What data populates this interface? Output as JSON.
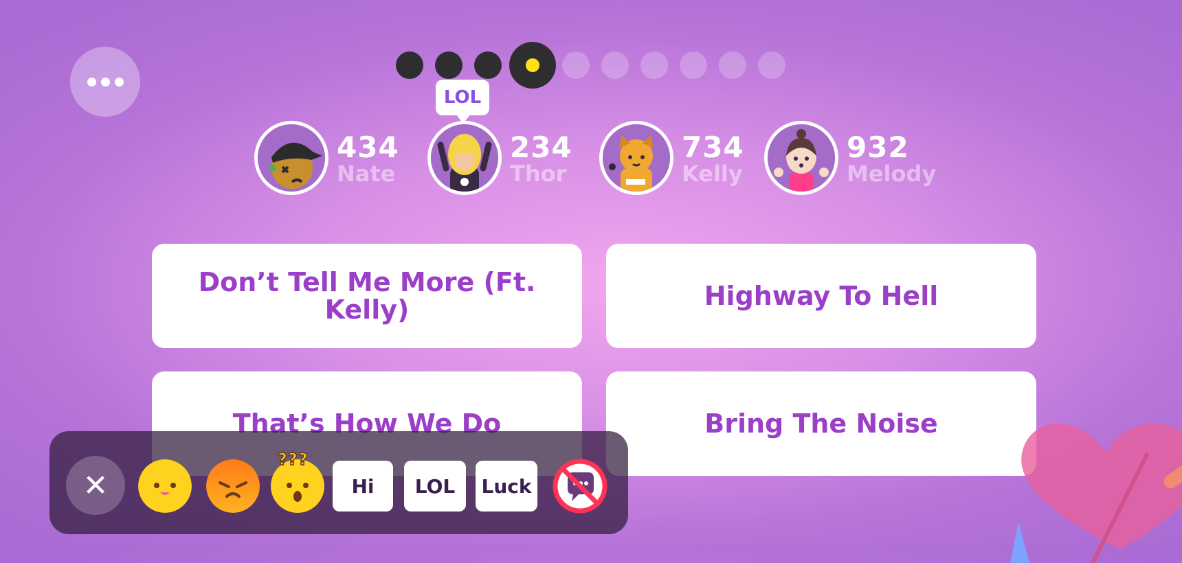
{
  "progress": {
    "total": 10,
    "completed": 3,
    "current": 4,
    "colors": {
      "done": "#2e2e30",
      "current_dot": "#ffe11a"
    }
  },
  "players": [
    {
      "name": "Nate",
      "score": "434",
      "avatar": "nate-avatar"
    },
    {
      "name": "Thor",
      "score": "234",
      "avatar": "thor-avatar"
    },
    {
      "name": "Kelly",
      "score": "734",
      "avatar": "kelly-avatar"
    },
    {
      "name": "Melody",
      "score": "932",
      "avatar": "melody-avatar"
    }
  ],
  "speech_bubble": {
    "text": "LOL",
    "player": "Thor"
  },
  "answers": [
    "Don’t Tell Me More (Ft. Kelly)",
    "Highway To Hell",
    "That’s How We Do",
    "Bring The Noise"
  ],
  "chat": {
    "close_icon": "close-icon",
    "emojis": [
      "happy-emoji",
      "angry-emoji",
      "confused-emoji"
    ],
    "confused_marks": "???",
    "phrases": [
      "Hi",
      "LOL",
      "Luck"
    ],
    "mute_icon": "mute-chat-icon"
  },
  "colors": {
    "accent": "#9b3fc8",
    "bubble_text": "#8a4fe0",
    "mute": "#ff3355"
  }
}
